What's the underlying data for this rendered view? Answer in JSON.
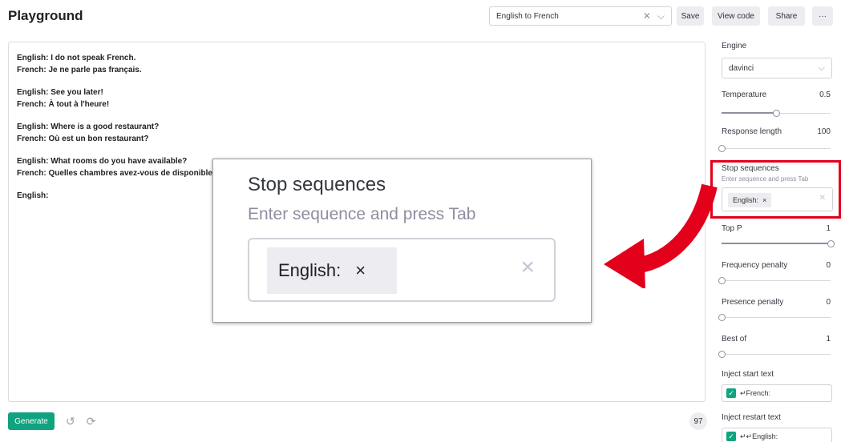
{
  "header": {
    "title": "Playground",
    "preset": "English to French",
    "clear_icon": "close-icon",
    "chevron_icon": "chevron-down-icon",
    "buttons": {
      "save": "Save",
      "view_code": "View code",
      "share": "Share",
      "more": "···"
    }
  },
  "editor": {
    "lines": [
      "English: I do not speak French.",
      "French: Je ne parle pas français.",
      "",
      "English: See you later!",
      "French: À tout à l'heure!",
      "",
      "English: Where is a good restaurant?",
      "French: Où est un bon restaurant?",
      "",
      "English: What rooms do you have available?",
      "French: Quelles chambres avez-vous de disponible?",
      "",
      "English:"
    ]
  },
  "footer": {
    "generate": "Generate",
    "undo_icon": "undo-icon",
    "regenerate_icon": "regenerate-icon",
    "token_count": "97"
  },
  "settings": {
    "engine": {
      "label": "Engine",
      "value": "davinci"
    },
    "temperature": {
      "label": "Temperature",
      "value": "0.5",
      "level": 0.5
    },
    "response_length": {
      "label": "Response length",
      "value": "100",
      "level": 0.0
    },
    "stop_sequences": {
      "label": "Stop sequences",
      "hint": "Enter sequence and press Tab",
      "chip": "English:"
    },
    "top_p": {
      "label": "Top P",
      "value": "1",
      "level": 1.0
    },
    "frequency_penalty": {
      "label": "Frequency penalty",
      "value": "0",
      "level": 0.0
    },
    "presence_penalty": {
      "label": "Presence penalty",
      "value": "0",
      "level": 0.0
    },
    "best_of": {
      "label": "Best of",
      "value": "1",
      "level": 0.0
    },
    "inject_start": {
      "label": "Inject start text",
      "value": "↵French:",
      "checked": true
    },
    "inject_restart": {
      "label": "Inject restart text",
      "value": "↵↵English:",
      "checked": true
    }
  },
  "callout": {
    "title": "Stop sequences",
    "hint": "Enter sequence and press Tab",
    "chip": "English:",
    "chip_remove": "×",
    "clear": "×",
    "highlight_color": "#e3001b"
  }
}
